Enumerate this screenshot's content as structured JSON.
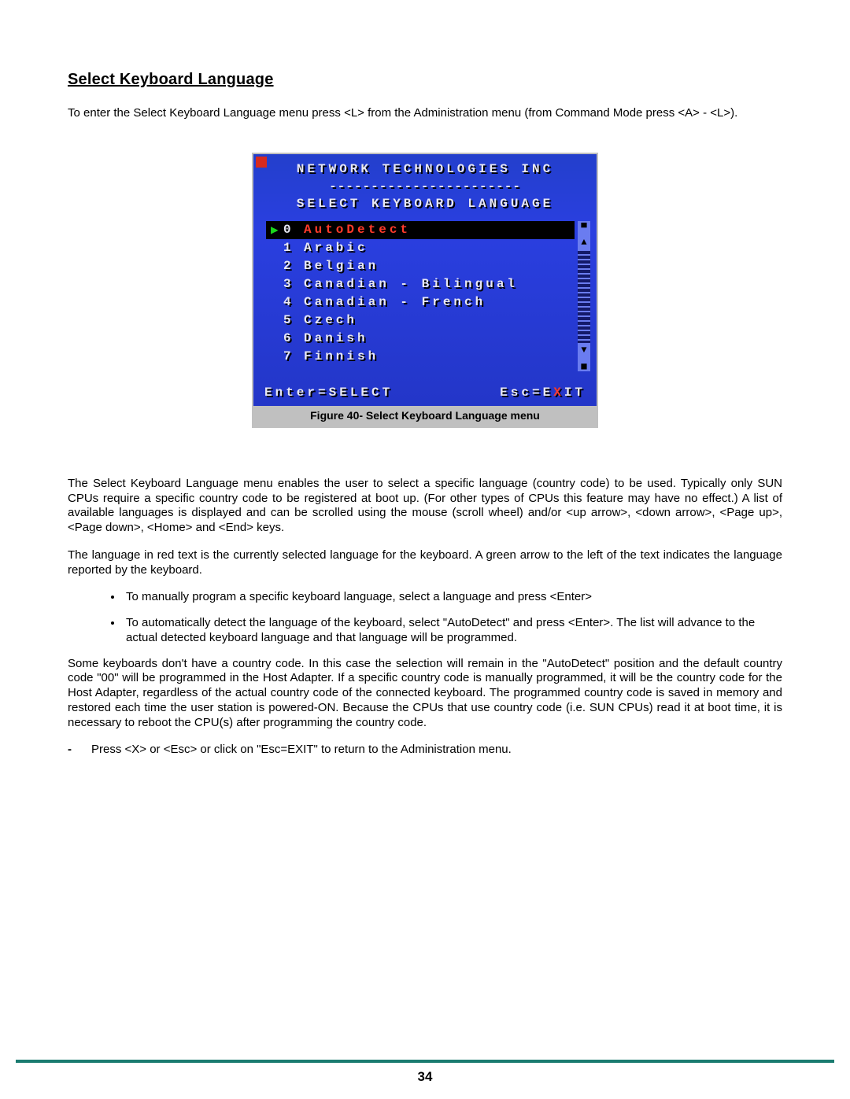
{
  "heading": "Select Keyboard Language",
  "intro": "To enter the Select Keyboard Language menu press <L> from the Administration menu  (from Command Mode press <A> - <L>).",
  "figure": {
    "company": "NETWORK TECHNOLOGIES INC",
    "dashes": "-----------------------",
    "menu_title": "SELECT KEYBOARD LANGUAGE",
    "rows": [
      {
        "num": "0",
        "name": "AutoDetect",
        "selected": true,
        "arrow": true
      },
      {
        "num": "1",
        "name": "Arabic",
        "selected": false,
        "arrow": false
      },
      {
        "num": "2",
        "name": "Belgian",
        "selected": false,
        "arrow": false
      },
      {
        "num": "3",
        "name": "Canadian - Bilingual",
        "selected": false,
        "arrow": false
      },
      {
        "num": "4",
        "name": "Canadian - French",
        "selected": false,
        "arrow": false
      },
      {
        "num": "5",
        "name": "Czech",
        "selected": false,
        "arrow": false
      },
      {
        "num": "6",
        "name": "Danish",
        "selected": false,
        "arrow": false
      },
      {
        "num": "7",
        "name": "Finnish",
        "selected": false,
        "arrow": false
      }
    ],
    "footer_left": "Enter=SELECT",
    "footer_right_pre": "Esc=E",
    "footer_right_x": "X",
    "footer_right_post": "IT",
    "caption": "Figure 40- Select Keyboard Language menu"
  },
  "para1": "The Select Keyboard Language menu enables the user to select a specific language (country code) to be used.   Typically only SUN CPUs require a specific country code to be registered at boot up. (For other types of CPUs this feature may have no effect.) A list of available languages is displayed and can be scrolled using the mouse (scroll wheel) and/or <up arrow>,  <down arrow>, <Page up>, <Page down>, <Home> and <End> keys.",
  "para2": "The language in red text is the currently selected language for the keyboard.    A green arrow to the left of the text indicates the language reported by the keyboard.",
  "bullet1": "To manually program a specific keyboard language, select a language and press <Enter>",
  "bullet2": "To automatically detect the language of the keyboard, select \"AutoDetect\" and press <Enter>.   The list will advance to the actual detected keyboard language and that language will be programmed.",
  "para3": "Some keyboards don't have a country code. In this case the selection will remain in the \"AutoDetect\" position and the default country code \"00\" will be programmed in the Host Adapter. If a specific country code is manually programmed, it will be the country code for the Host Adapter, regardless of the actual country code of the connected keyboard. The programmed country code is saved in memory and restored each time the user station is powered-ON.  Because the CPUs that use country code (i.e. SUN CPUs) read it at boot time, it is necessary to reboot the CPU(s) after programming the country code.",
  "dash_item": "Press <X> or  <Esc>  or click on \"Esc=EXIT\" to return to the Administration menu.",
  "page_number": "34"
}
